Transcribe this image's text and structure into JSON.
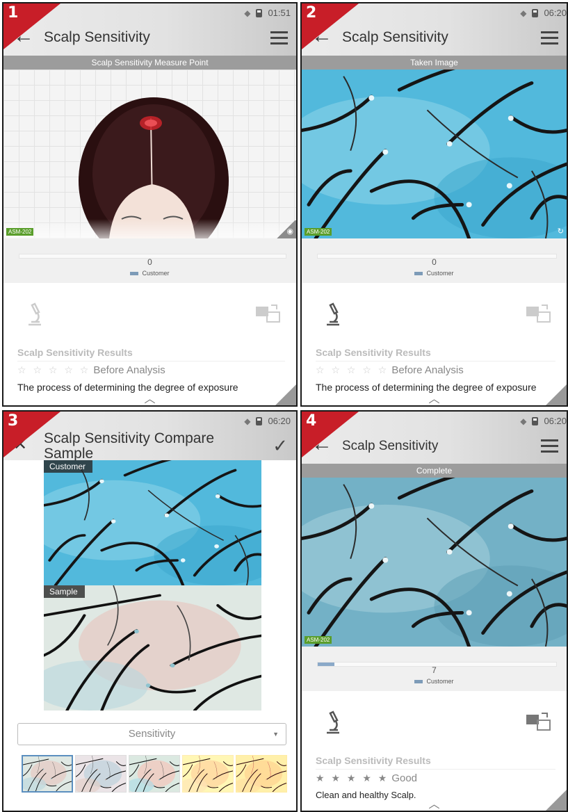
{
  "panels": [
    {
      "number": "1",
      "time": "01:51",
      "title": "Scalp Sensitivity",
      "image_label": "Scalp Sensitivity Measure Point",
      "device_tag": "ASM-202",
      "gauge_value": "0",
      "gauge_fraction": 0,
      "legend": "Customer",
      "results_title": "Scalp Sensitivity Results",
      "rating": "☆ ☆ ☆ ☆ ☆",
      "rating_text": "Before Analysis",
      "description": "The process of determining the degree of exposure"
    },
    {
      "number": "2",
      "time": "06:20",
      "title": "Scalp Sensitivity",
      "image_label": "Taken Image",
      "device_tag": "ASM-202",
      "gauge_value": "0",
      "gauge_fraction": 0,
      "legend": "Customer",
      "results_title": "Scalp Sensitivity Results",
      "rating": "☆ ☆ ☆ ☆ ☆",
      "rating_text": "Before Analysis",
      "description": "The process of determining the degree of exposure"
    },
    {
      "number": "3",
      "time": "06:20",
      "title": "Scalp Sensitivity Compare Sample",
      "customer_label": "Customer",
      "sample_label": "Sample",
      "select_value": "Sensitivity"
    },
    {
      "number": "4",
      "time": "06:20",
      "title": "Scalp Sensitivity",
      "image_label": "Complete",
      "device_tag": "ASM-202",
      "gauge_value": "7",
      "gauge_fraction": 0.07,
      "legend": "Customer",
      "results_title": "Scalp Sensitivity Results",
      "rating": "★ ★ ★ ★ ★",
      "rating_text": "Good",
      "description": "Clean and healthy Scalp."
    }
  ],
  "colors": {
    "badge": "#c81e28",
    "gauge_fill": "#8ba9c8",
    "device_tag": "#5a9e2b",
    "scalp_blue": "#5bbcdc"
  },
  "icons": [
    "back-arrow-icon",
    "menu-icon",
    "close-icon",
    "check-icon",
    "microscope-icon",
    "compare-icon",
    "camera-icon",
    "rotate-icon",
    "chevron-up-icon",
    "wifi-icon",
    "battery-icon"
  ]
}
